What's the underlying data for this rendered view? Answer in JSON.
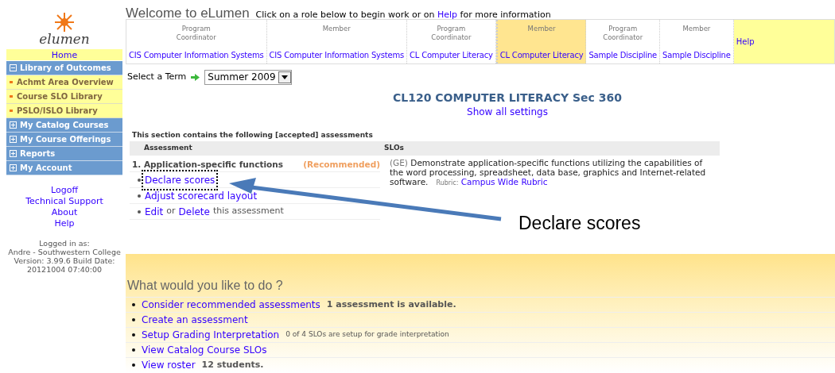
{
  "logo": {
    "text": "elumen"
  },
  "sidebar": {
    "items": [
      {
        "kind": "home",
        "label": "Home"
      },
      {
        "kind": "section",
        "label": "Library of Outcomes",
        "expanded": true,
        "children": [
          {
            "label": "Achmt Area Overview"
          },
          {
            "label": "Course SLO Library"
          },
          {
            "label": "PSLO/ISLO Library"
          }
        ]
      },
      {
        "kind": "section",
        "label": "My Catalog Courses",
        "expanded": false
      },
      {
        "kind": "section",
        "label": "My Course Offerings",
        "expanded": false
      },
      {
        "kind": "section",
        "label": "Reports",
        "expanded": false
      },
      {
        "kind": "section",
        "label": "My Account",
        "expanded": false
      }
    ],
    "links": [
      "Logoff",
      "Technical Support",
      "About",
      "Help"
    ],
    "footer": [
      "Logged in as:",
      "Andre - Southwestern College",
      "Version: 3.99.6 Build Date: 20121004 07:40:00"
    ]
  },
  "header": {
    "title": "Welcome to eLumen",
    "intro_before": "Click on a role below to begin work or on",
    "intro_link": "Help",
    "intro_after": "for more information"
  },
  "roles": [
    {
      "role": "Program Coordinator",
      "unit": "CIS Computer Information Systems",
      "selected": false
    },
    {
      "role": "Member",
      "unit": "CIS Computer Information Systems",
      "selected": false
    },
    {
      "role": "Program Coordinator",
      "unit": "CL Computer Literacy",
      "selected": false
    },
    {
      "role": "Member",
      "unit": "CL Computer Literacy",
      "selected": true
    },
    {
      "role": "Program Coordinator",
      "unit": "Sample Discipline",
      "selected": false
    },
    {
      "role": "Member",
      "unit": "Sample Discipline",
      "selected": false
    }
  ],
  "roles_help": "Help",
  "term": {
    "label": "Select a Term",
    "value": "Summer 2009"
  },
  "course": {
    "title": "CL120 COMPUTER LITERACY Sec 360",
    "settings_link": "Show all settings"
  },
  "assessments": {
    "caption": "This section contains the following [accepted] assessments",
    "columns": [
      "Assessment",
      "SLOs"
    ],
    "rows": [
      {
        "name": "1. Application-specific functions",
        "tag": "(Recommended)",
        "slo_prefix": "(GE)",
        "slo": "Demonstrate application-specific functions utilizing the capabilities of the word processing, spreadsheet, data base, graphics and Internet-related software.",
        "rubric_label": "Rubric:",
        "rubric": "Campus Wide Rubric",
        "actions": [
          {
            "kind": "link",
            "label": "Declare scores",
            "highlighted": true
          },
          {
            "kind": "link",
            "label": "Adjust scorecard layout",
            "highlighted": false
          },
          {
            "kind": "edit",
            "edit": "Edit",
            "or": "or",
            "delete": "Delete",
            "rest": "this assessment",
            "highlighted": false
          }
        ]
      }
    ]
  },
  "callout": {
    "text": "Declare scores"
  },
  "todo": {
    "title": "What would you like to do ?",
    "items": [
      {
        "link": "Consider recommended assessments",
        "note": "1 assessment is available.",
        "bold": true
      },
      {
        "link": "Create an assessment"
      },
      {
        "link": "Setup Grading Interpretation",
        "note": "0 of 4 SLOs are setup for grade interpretation",
        "bold": false
      },
      {
        "link": "View Catalog Course SLOs"
      },
      {
        "link": "View roster",
        "note": "12 students.",
        "bold": true
      }
    ]
  }
}
